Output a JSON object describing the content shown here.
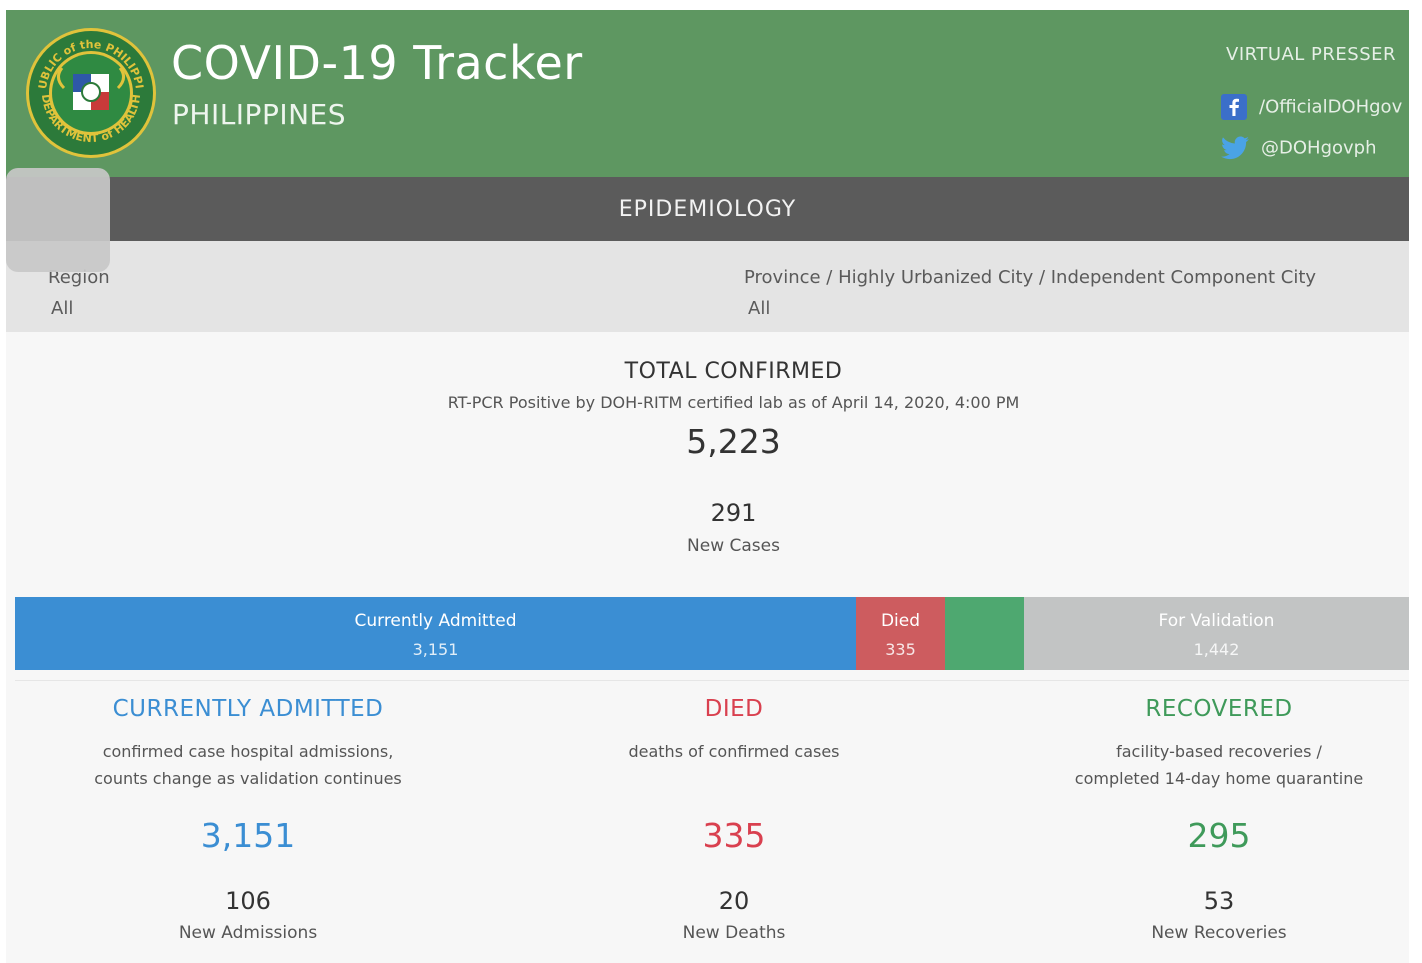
{
  "header": {
    "title": "COVID-19 Tracker",
    "subtitle": "PHILIPPINES",
    "presser": "VIRTUAL PRESSER",
    "facebook": "/OfficialDOHgov",
    "twitter": "@DOHgovph",
    "seal_text_top": "REPUBLIC of the PHILIPPINES",
    "seal_text_bottom": "DEPARTMENT of HEALTH",
    "colors": {
      "background": "#5e9761",
      "seal_green": "#2c7a3a",
      "seal_gold": "#e0c33b"
    }
  },
  "section": {
    "title": "EPIDEMIOLOGY"
  },
  "filters": {
    "region_label": "Region",
    "region_value": "All",
    "province_label": "Province / Highly Urbanized City / Independent Component City",
    "province_value": "All"
  },
  "totals": {
    "heading": "TOTAL CONFIRMED",
    "subheading": "RT-PCR Positive by DOH-RITM certified lab as of April 14, 2020, 4:00 PM",
    "value": "5,223",
    "new_cases": "291",
    "new_cases_label": "New Cases"
  },
  "breakdown_bar": {
    "total": 5223,
    "segments": [
      {
        "label": "Currently Admitted",
        "value": 3151,
        "display": "3,151",
        "color": "#3b8ed3"
      },
      {
        "label": "Died",
        "value": 335,
        "display": "335",
        "color": "#cd5c5f"
      },
      {
        "label": "",
        "value": 295,
        "display": "",
        "color": "#4ea870"
      },
      {
        "label": "For Validation",
        "value": 1442,
        "display": "1,442",
        "color": "#c2c4c4"
      }
    ]
  },
  "columns": [
    {
      "title": "CURRENTLY ADMITTED",
      "color": "#3b8ed3",
      "desc1": "confirmed case hospital admissions,",
      "desc2": "counts change as validation continues",
      "value": "3,151",
      "new_value": "106",
      "new_label": "New Admissions"
    },
    {
      "title": "DIED",
      "color": "#d9404f",
      "desc1": "deaths of confirmed cases",
      "desc2": "",
      "value": "335",
      "new_value": "20",
      "new_label": "New Deaths"
    },
    {
      "title": "RECOVERED",
      "color": "#3f9a5a",
      "desc1": "facility-based recoveries /",
      "desc2": "completed 14-day home quarantine",
      "value": "295",
      "new_value": "53",
      "new_label": "New Recoveries"
    }
  ]
}
